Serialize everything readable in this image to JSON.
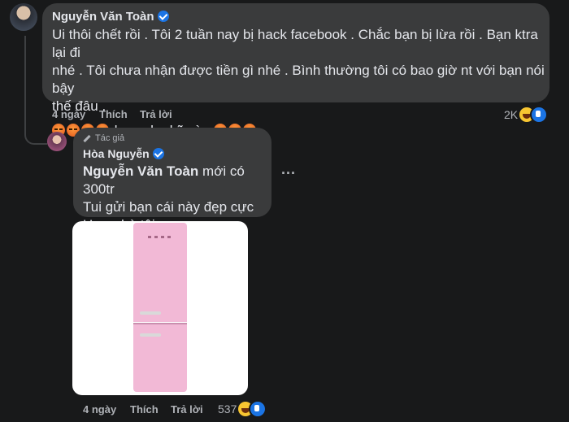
{
  "comment1": {
    "author": "Nguyễn Văn Toàn",
    "line1": "Ui thôi chết rồi . Tôi 2 tuần nay bị hack facebook . Chắc bạn bị lừa rồi . Bạn ktra lại đi",
    "line2": "nhé . Tôi chưa nhận được tiền gì nhé . Bình thường tôi có bao giờ nt với bạn nói bậy",
    "line3": "thế đâu .",
    "line4_text": "lsau che kỹ vào",
    "time": "4 ngày",
    "like_label": "Thích",
    "reply_label": "Trả lời",
    "reaction_count": "2K",
    "emoji_left": "angry-face-icon",
    "emoji_right": "angry-face-icon"
  },
  "comment2": {
    "badge": "Tác giả",
    "author": "Hòa Nguyễn",
    "mention": "Nguyễn Văn Toàn",
    "line1_rest": " mới có 300tr",
    "line2": "Tui gửi bạn cái này đẹp cực",
    "line3": "Hợp nhà tôi",
    "more": "...",
    "time": "4 ngày",
    "like_label": "Thích",
    "reply_label": "Trả lời",
    "reaction_count": "537",
    "image": "pink-refrigerator"
  },
  "colors": {
    "background": "#18191a",
    "bubble": "#3a3b3c",
    "text": "#e4e6eb",
    "meta": "#b0b3b8",
    "verified": "#1b74e4",
    "fridge": "#f2b9d6"
  }
}
